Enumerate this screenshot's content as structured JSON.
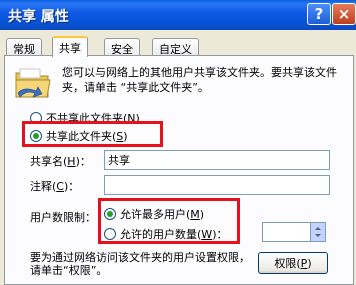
{
  "window": {
    "title": "共享 属性",
    "help_glyph": "?",
    "close_glyph": "×"
  },
  "tabs": [
    {
      "label": "常规",
      "active": false
    },
    {
      "label": "共享",
      "active": true
    },
    {
      "label": "安全",
      "active": false
    },
    {
      "label": "自定义",
      "active": false
    }
  ],
  "description": "您可以与网络上的其他用户共享该文件夹。要共享该文件夹，请单击 “共享此文件夹”。",
  "sharing": {
    "not_shared_label": "不共享此文件夹",
    "not_shared_key": "N",
    "shared_label": "共享此文件夹",
    "shared_key": "S",
    "selected": "share"
  },
  "share_name": {
    "label": "共享名",
    "key": "H",
    "value": "共享"
  },
  "comment": {
    "label": "注释",
    "key": "C",
    "value": ""
  },
  "user_limit": {
    "label": "用户数限制：",
    "max_label": "允许最多用户",
    "max_key": "M",
    "count_label": "允许的用户数量",
    "count_key": "W",
    "count_value": "",
    "selected": "max"
  },
  "bottom": {
    "note": "要为通过网络访问该文件夹的用户设置权限，请单击“权限”。",
    "permissions_label": "权限",
    "permissions_key": "P"
  },
  "colors": {
    "highlight": "#e8101a",
    "titlebar": "#0a5ee0",
    "dialog_bg": "#ece9d8"
  }
}
